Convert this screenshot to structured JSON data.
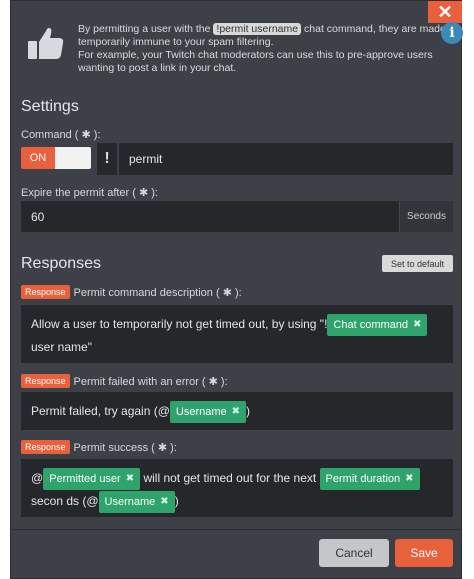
{
  "close_label": "✕",
  "info_label": "i",
  "intro": {
    "text_before": "By permitting a user with the ",
    "code": "!permit username",
    "text_after": " chat command, they are made temporarily immune to your spam filtering.",
    "line2": "For example, your Twitch chat moderators can use this to pre-approve users wanting to post a link in your chat."
  },
  "settings": {
    "title": "Settings",
    "command_label": "Command ( ✱ ):",
    "toggle_label": "ON",
    "bang": "!",
    "command_value": "permit",
    "expire_label": "Expire the permit after ( ✱ ):",
    "expire_value": "60",
    "expire_unit": "Seconds"
  },
  "responses": {
    "title": "Responses",
    "set_default": "Set to default",
    "items": [
      {
        "tag": "Response",
        "label": "Permit command description ( ✱ ):",
        "text1": "Allow a user to temporarily not get timed out, by using \"!",
        "chip1": "Chat command",
        "text2": " user name\""
      },
      {
        "tag": "Response",
        "label": "Permit failed with an error ( ✱ ):",
        "text1": "Permit failed, try again (@",
        "chip1": "Username",
        "text2": ")"
      },
      {
        "tag": "Response",
        "label": "Permit success ( ✱ ):",
        "text1": "@",
        "chip1": "Permitted user",
        "text2": " will not get timed out for the next ",
        "chip2": "Permit duration",
        "text3": " secon ds (@",
        "chip3": "Username",
        "text4": ")"
      }
    ]
  },
  "footer": {
    "cancel": "Cancel",
    "save": "Save"
  },
  "colors": {
    "accent": "#e8603c",
    "chip": "#2ea36b",
    "panel": "#3d4046",
    "input": "#25272b"
  },
  "icons": [
    "thumbs-up-icon",
    "close-icon",
    "info-icon",
    "remove-chip-icon"
  ]
}
